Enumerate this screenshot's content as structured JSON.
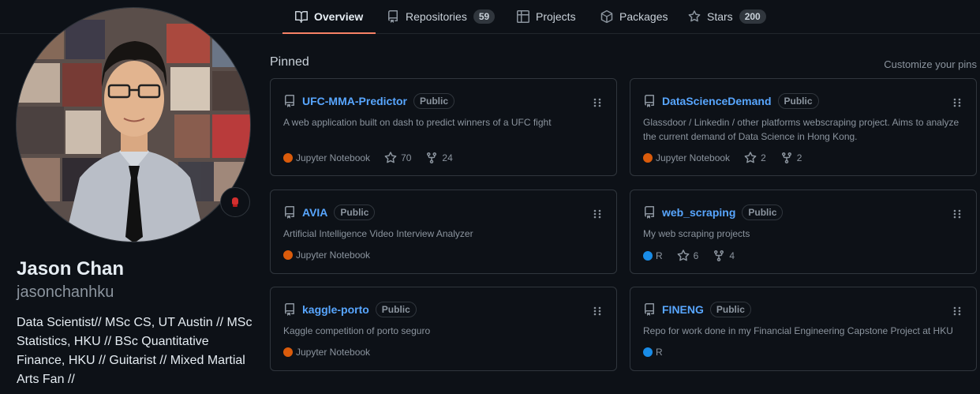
{
  "nav": {
    "tabs": [
      {
        "label": "Overview",
        "count": ""
      },
      {
        "label": "Repositories",
        "count": "59"
      },
      {
        "label": "Projects",
        "count": ""
      },
      {
        "label": "Packages",
        "count": ""
      },
      {
        "label": "Stars",
        "count": "200"
      }
    ]
  },
  "profile": {
    "name": "Jason Chan",
    "username": "jasonchanhku",
    "bio": "Data Scientist// MSc CS, UT Austin // MSc Statistics, HKU // BSc Quantitative Finance, HKU // Guitarist // Mixed Martial Arts Fan //",
    "status_icon": "boxing-glove-icon"
  },
  "pinned": {
    "title": "Pinned",
    "customize": "Customize your pins",
    "repos": [
      {
        "name": "UFC-MMA-Predictor",
        "visibility": "Public",
        "description": "A web application built on dash to predict winners of a UFC fight",
        "language": "Jupyter Notebook",
        "language_color": "#DA5B0B",
        "stars": "70",
        "forks": "24"
      },
      {
        "name": "DataScienceDemand",
        "visibility": "Public",
        "description": "Glassdoor / Linkedin / other platforms webscraping project. Aims to analyze the current demand of Data Science in Hong Kong.",
        "language": "Jupyter Notebook",
        "language_color": "#DA5B0B",
        "stars": "2",
        "forks": "2"
      },
      {
        "name": "AVIA",
        "visibility": "Public",
        "description": "Artificial Intelligence Video Interview Analyzer",
        "language": "Jupyter Notebook",
        "language_color": "#DA5B0B"
      },
      {
        "name": "web_scraping",
        "visibility": "Public",
        "description": "My web scraping projects",
        "language": "R",
        "language_color": "#198CE7",
        "stars": "6",
        "forks": "4"
      },
      {
        "name": "kaggle-porto",
        "visibility": "Public",
        "description": "Kaggle competition of porto seguro",
        "language": "Jupyter Notebook",
        "language_color": "#DA5B0B"
      },
      {
        "name": "FINENG",
        "visibility": "Public",
        "description": "Repo for work done in my Financial Engineering Capstone Project at HKU",
        "language": "R",
        "language_color": "#198CE7"
      }
    ]
  },
  "colors": {
    "accent": "#f78166",
    "link": "#58a6ff",
    "background": "#0d1117",
    "border": "#30363d"
  }
}
